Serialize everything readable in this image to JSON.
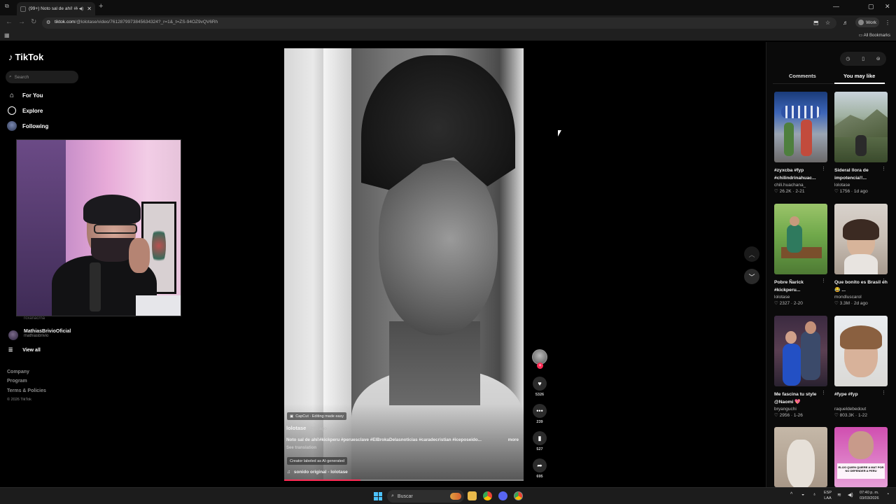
{
  "browser": {
    "tab_title": "(99+) Noto sal de ahí! #kick",
    "url_domain": "tiktok.com",
    "url_path": "/@lolotase/video/7612879973845634324?_r=1&_t=ZS-94OZ9vQV6Rh",
    "profile_label": "Work",
    "bookmarks_label": "All Bookmarks"
  },
  "sidebar": {
    "logo": "TikTok",
    "search_placeholder": "Search",
    "nav": [
      {
        "label": "For You",
        "icon": "home-icon"
      },
      {
        "label": "Explore",
        "icon": "compass-icon"
      },
      {
        "label": "Following",
        "icon": "avatar-icon"
      }
    ],
    "followed_partial_handle": "roxanacrna",
    "followed_account": {
      "name": "MathiasBrivioOficial",
      "handle": "mathiasbrivio"
    },
    "view_all": "View all",
    "footer": [
      "Company",
      "Program",
      "Terms & Policies"
    ],
    "copyright": "© 2026 TikTok"
  },
  "video": {
    "capcut_badge": "CapCut · Editing made easy",
    "author": "lolotase",
    "posted": "· 21h ago",
    "caption": "Noto sal de ahí!#kickperu #peruesclave #ElBrokaDelasnoticias #caradecristian #iceposeido...",
    "more": "more",
    "see_translation": "See translation",
    "ai_label": "Creator labeled as AI-generated",
    "sound": "sonido original - lolotase",
    "progress": 0.32,
    "actions": {
      "likes": "5326",
      "comments": "239",
      "saves": "527",
      "shares": "695"
    }
  },
  "right_panel": {
    "tabs": {
      "comments": "Comments",
      "you_may_like": "You may like"
    },
    "cards": [
      {
        "title": "#zyxcba #fyp #chilindrinahuac...",
        "author": "chili.huachana_",
        "likes": "26.2K",
        "date": "2-21"
      },
      {
        "title": "Sideral llora de impotencia!!...",
        "author": "lolotase",
        "likes": "1756",
        "date": "1d ago"
      },
      {
        "title": "Pobre Ñarick #kickperu...",
        "author": "lolotase",
        "likes": "2327",
        "date": "2-20"
      },
      {
        "title": "Que bonito es Brasil eh 😂 ...",
        "author": "mondluscarol",
        "likes": "3.3M",
        "date": "2d ago"
      },
      {
        "title": "Me fascina tu style @Naomi 💖",
        "author": "bryanguchi",
        "likes": "2956",
        "date": "1-26"
      },
      {
        "title": "#fype #fyp",
        "author": "raqueldebedout",
        "likes": "803.3K",
        "date": "1-22"
      },
      {
        "title": "",
        "author": "",
        "likes": "",
        "date": ""
      },
      {
        "title": "",
        "author": "",
        "likes": "",
        "date": ""
      }
    ],
    "card8_overlay": "ELIJO QUIEN QUIERE A MAT POR NO DEFENDER A PERU"
  },
  "taskbar": {
    "search_label": "Buscar",
    "lang_top": "ESP",
    "lang_bottom": "LAA",
    "time": "07:40 p. m.",
    "date": "03/03/2026"
  },
  "colors": {
    "accent": "#fe2c55",
    "windows_blue": "#4cc2ff"
  }
}
